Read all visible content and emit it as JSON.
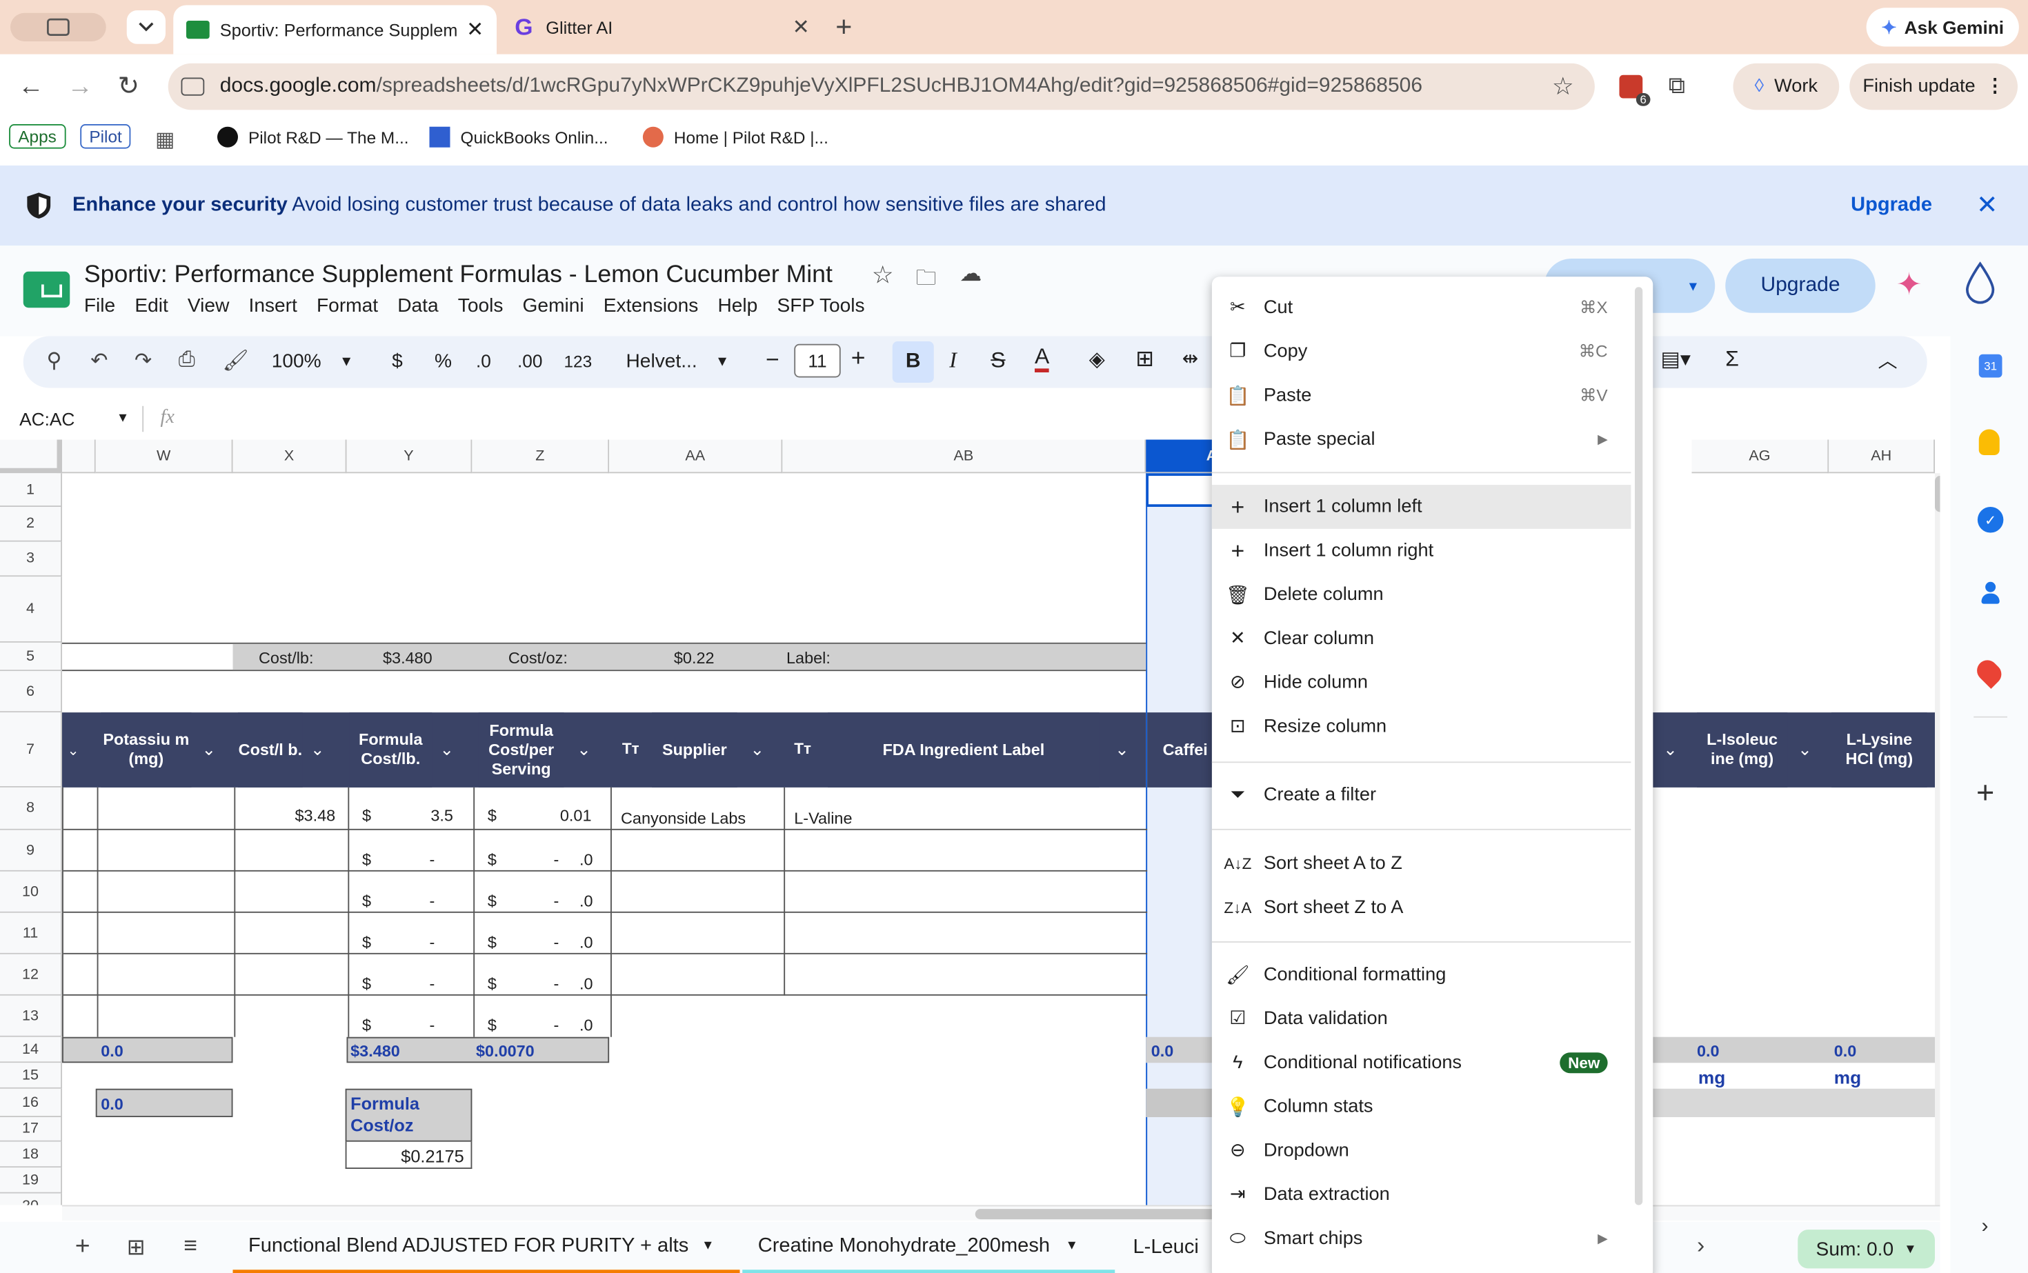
{
  "browser": {
    "tabs": [
      {
        "title": "Sportiv: Performance Supplem"
      },
      {
        "title": "Glitter AI"
      }
    ],
    "ask_gemini": "Ask Gemini",
    "url_host": "docs.google.com",
    "url_path": "/spreadsheets/d/1wcRGpu7yNxWPrCKZ9puhjeVyXlPFL2SUcHBJ1OM4Ahg/edit?gid=925868506#gid=925868506",
    "ext_badge": "6",
    "profile": "Work",
    "finish_update": "Finish update",
    "bookmarks": [
      "Apps",
      "Pilot",
      "Pilot R&D — The M...",
      "QuickBooks Onlin...",
      "Home | Pilot R&D |..."
    ]
  },
  "banner": {
    "bold": "Enhance your security",
    "text": "Avoid losing customer trust because of data leaks and control how sensitive files are shared",
    "action": "Upgrade"
  },
  "doc": {
    "title": "Sportiv: Performance Supplement Formulas - Lemon Cucumber Mint",
    "menus": [
      "File",
      "Edit",
      "View",
      "Insert",
      "Format",
      "Data",
      "Tools",
      "Gemini",
      "Extensions",
      "Help",
      "SFP Tools"
    ],
    "upgrade": "Upgrade"
  },
  "toolbar": {
    "zoom": "100%",
    "currency": "$",
    "percent": "%",
    "dec_less": ".0",
    "dec_more": ".00",
    "format_num": "123",
    "font": "Helvet...",
    "font_size": "11"
  },
  "formula": {
    "namebox": "AC:AC",
    "fx": "fx"
  },
  "grid": {
    "columns": [
      "W",
      "X",
      "Y",
      "Z",
      "AA",
      "AB",
      "A",
      "AG",
      "AH"
    ],
    "rows": [
      "1",
      "2",
      "3",
      "4",
      "5",
      "6",
      "7",
      "8",
      "9",
      "10",
      "11",
      "12",
      "13",
      "14",
      "15",
      "16",
      "17",
      "18",
      "19",
      "20"
    ],
    "row5": {
      "costlb_label": "Cost/lb:",
      "costlb_value": "$3.480",
      "costoz_label": "Cost/oz:",
      "costoz_value": "$0.22",
      "label_label": "Label:"
    },
    "headers": {
      "potassium": "Potassiu m (mg)",
      "costlb": "Cost/l b.",
      "formula_costlb": "Formula Cost/lb.",
      "formula_serving": "Formula Cost/per Serving",
      "supplier": "Supplier",
      "fda": "FDA Ingredient Label",
      "caffeine": "Caffei",
      "isoleucine": "L-Isoleuc ine (mg)",
      "lysine": "L-Lysine HCl (mg)"
    },
    "row8": {
      "x": "$3.48",
      "y_sym": "$",
      "y_val": "3.5",
      "z_sym": "$",
      "z_val": "0.01",
      "supplier": "Canyonside Labs",
      "fda": "L-Valine"
    },
    "dash_rows": {
      "sym": "$",
      "dash": "-",
      "zval": ".0"
    },
    "row14": {
      "w": "0.0",
      "y": "$3.480",
      "z": "$0.0070",
      "ac": "0.0",
      "ag": "0.0",
      "ah": "0.0"
    },
    "row15": {
      "ag": "mg",
      "ah": "mg"
    },
    "row16": {
      "w": "0.0",
      "box_title": "Formula Cost/oz",
      "box_value": "$0.2175"
    }
  },
  "context_menu": {
    "items": [
      {
        "label": "Cut",
        "shortcut": "⌘X"
      },
      {
        "label": "Copy",
        "shortcut": "⌘C"
      },
      {
        "label": "Paste",
        "shortcut": "⌘V"
      },
      {
        "label": "Paste special"
      },
      {
        "label": "Insert 1 column left"
      },
      {
        "label": "Insert 1 column right"
      },
      {
        "label": "Delete column"
      },
      {
        "label": "Clear column"
      },
      {
        "label": "Hide column"
      },
      {
        "label": "Resize column"
      },
      {
        "label": "Create a filter"
      },
      {
        "label": "Sort sheet A to Z"
      },
      {
        "label": "Sort sheet Z to A"
      },
      {
        "label": "Conditional formatting"
      },
      {
        "label": "Data validation"
      },
      {
        "label": "Conditional notifications",
        "badge": "New"
      },
      {
        "label": "Column stats"
      },
      {
        "label": "Dropdown"
      },
      {
        "label": "Data extraction"
      },
      {
        "label": "Smart chips"
      }
    ]
  },
  "sheets": {
    "tabs": [
      "Functional Blend ADJUSTED FOR PURITY + alts",
      "Creatine Monohydrate_200mesh",
      "L-Leuci"
    ],
    "sum": "Sum: 0.0"
  },
  "colors": {
    "header_bg": "#3a4366",
    "accent": "#0b57d0",
    "tab_strip": "#f6dccd",
    "banner": "#dfe9fb"
  }
}
